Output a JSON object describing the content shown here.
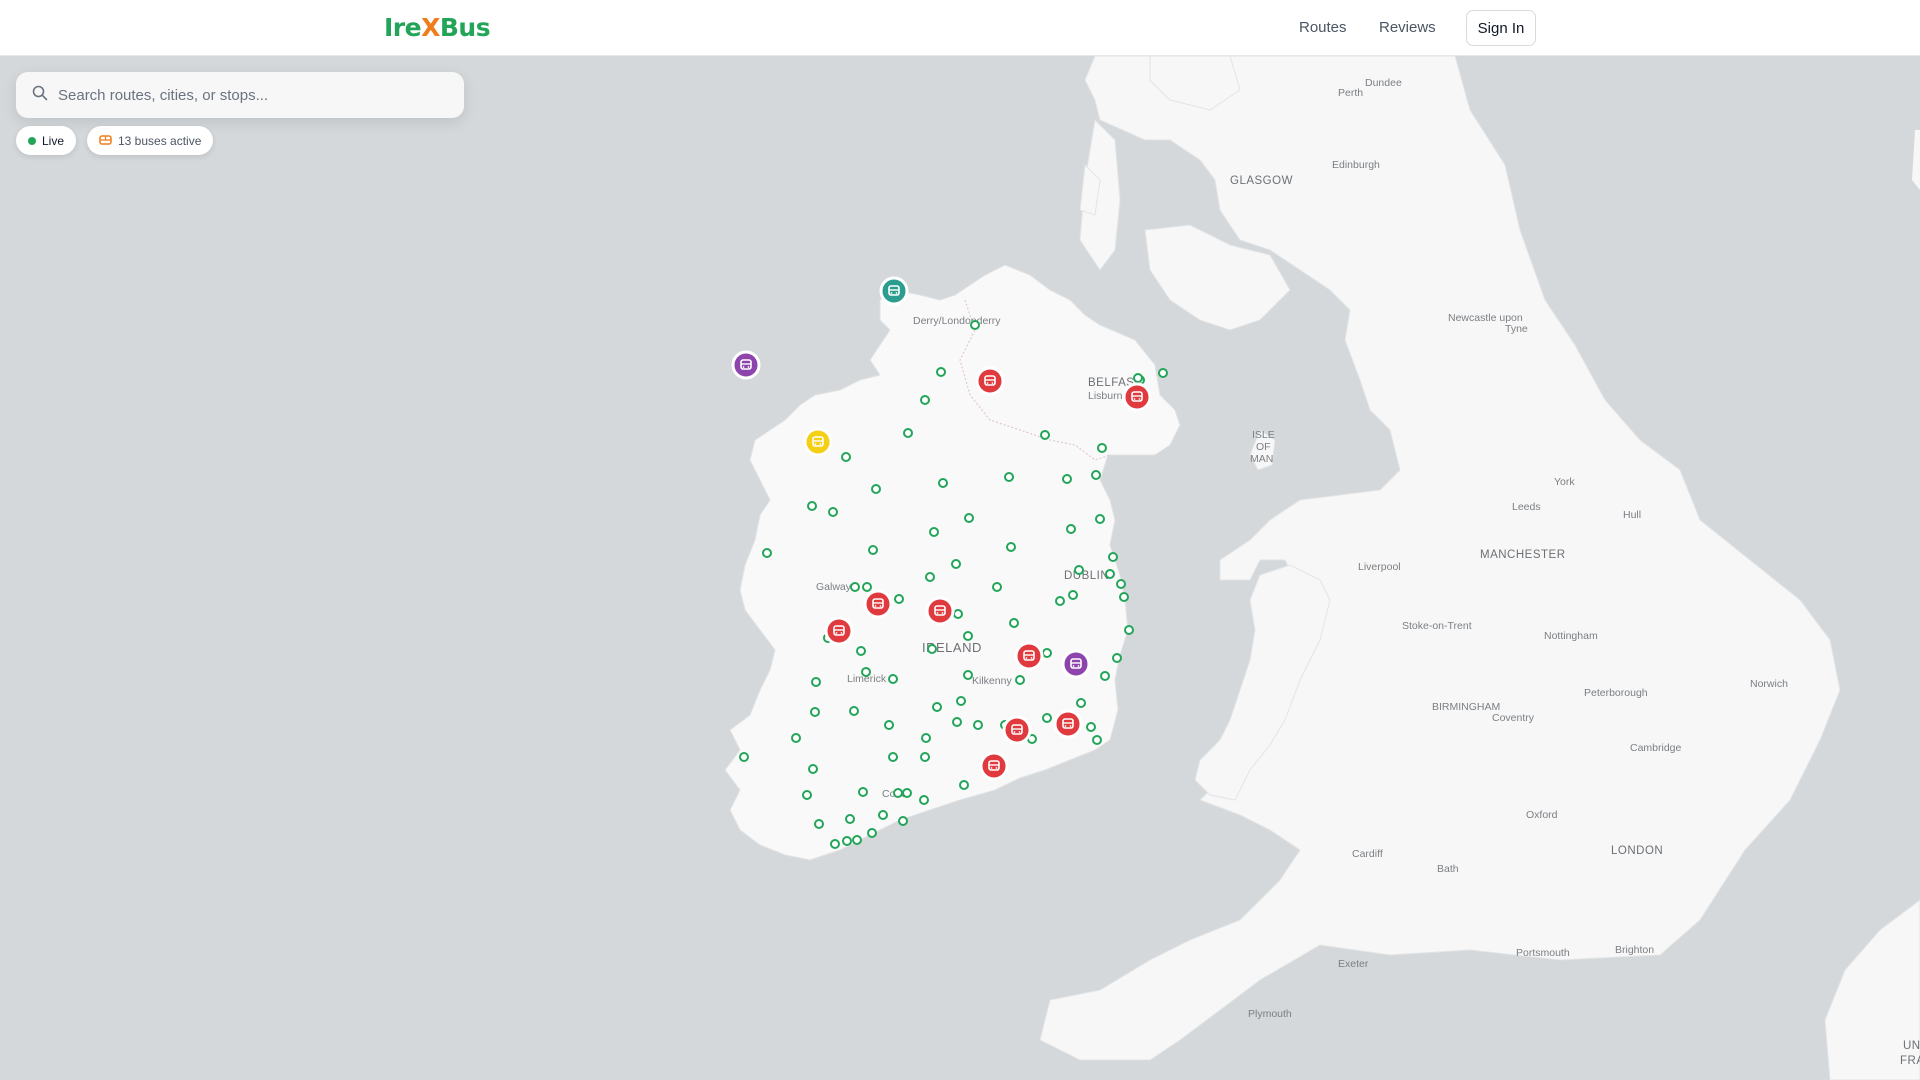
{
  "app": {
    "logo_part1": "Ire",
    "logo_part2": "X",
    "logo_part3": "Bus"
  },
  "nav": {
    "routes": "Routes",
    "reviews": "Reviews",
    "sign_in": "Sign In"
  },
  "search": {
    "placeholder": "Search routes, cities, or stops..."
  },
  "status": {
    "live": "Live",
    "buses_active": "13 buses active"
  },
  "map": {
    "labels": {
      "perth": "Perth",
      "dundee": "Dundee",
      "edinburgh": "Edinburgh",
      "glasgow": "GLASGOW",
      "derry": "Derry/Londonderry",
      "belfast": "BELFAST",
      "lisburn": "Lisburn",
      "isle1": "ISLE",
      "isle2": "OF",
      "isle3": "MAN",
      "newcastle1": "Newcastle upon",
      "newcastle2": "Tyne",
      "york": "York",
      "leeds": "Leeds",
      "hull": "Hull",
      "liverpool": "Liverpool",
      "manchester": "MANCHESTER",
      "galway": "Galway",
      "dublin": "DUBLIN",
      "ireland": "IRELAND",
      "limerick": "Limerick",
      "kilkenny": "Kilkenny",
      "cork": "Cork",
      "stoke": "Stoke-on-Trent",
      "nottingham": "Nottingham",
      "birmingham": "BIRMINGHAM",
      "coventry": "Coventry",
      "peterborough": "Peterborough",
      "norwich": "Norwich",
      "cambridge": "Cambridge",
      "oxford": "Oxford",
      "cardiff": "Cardiff",
      "bath": "Bath",
      "london": "LONDON",
      "exeter": "Exeter",
      "portsmouth": "Portsmouth",
      "brighton": "Brighton",
      "plymouth": "Plymouth",
      "france1": "UN",
      "france2": "FRA"
    },
    "colors": {
      "water": "#d4d8da",
      "land": "#f7f7f7",
      "stop": "#22a559",
      "bus_red": "#e0393e",
      "bus_purple": "#8e44ad",
      "bus_teal": "#2a9d8f",
      "bus_yellow": "#f4cf14"
    }
  }
}
